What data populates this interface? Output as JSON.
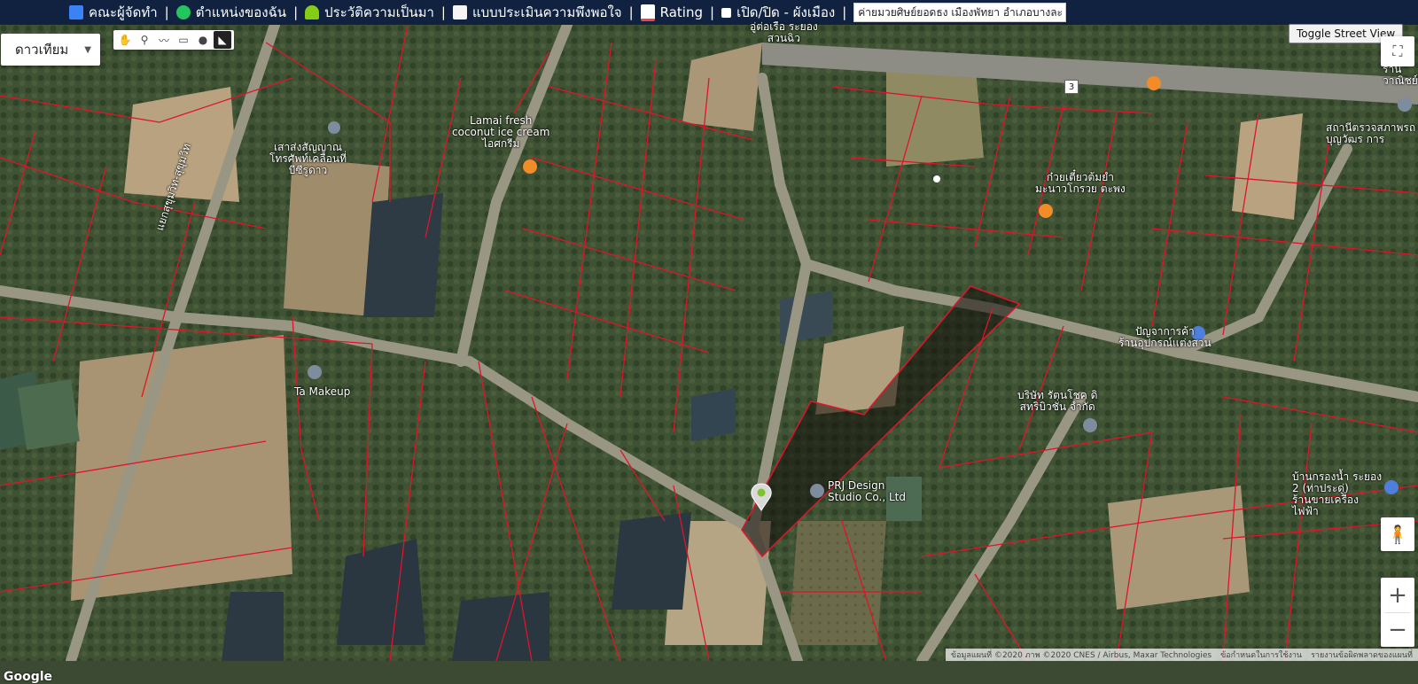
{
  "topbar": {
    "items": [
      {
        "label": "คณะผู้จัดทำ",
        "icon": "people-icon",
        "color": "#3b82f6"
      },
      {
        "label": "ตำแหน่งของฉัน",
        "icon": "globe-icon",
        "color": "#22c55e"
      },
      {
        "label": "ประวัติความเป็นมา",
        "icon": "sprout-icon",
        "color": "#84cc16"
      },
      {
        "label": "แบบประเมินความพึงพอใจ",
        "icon": "memo-icon",
        "color": "#f5f5f5"
      },
      {
        "label": "Rating",
        "icon": "chart-icon",
        "color": "#ef4444"
      },
      {
        "label": "เปิด/ปิด - ผังเมือง",
        "icon": "checkbox-icon",
        "color": "#ffffff"
      }
    ],
    "search_value": "ค่ายมวยศิษย์ยอดธง เมืองพัทยา อำเภอบางละ"
  },
  "map": {
    "map_type": "ดาวเทียม",
    "toggle_street_view": "Toggle Street View",
    "google": "Google",
    "route_number": "3",
    "attribution": [
      "ข้อมูลแผนที่ ©2020 ภาพ ©2020 CNES / Airbus, Maxar Technologies",
      "ข้อกำหนดในการใช้งาน",
      "รายงานข้อผิดพลาดของแผนที่"
    ],
    "labels": [
      {
        "id": "lamai",
        "text": "Lamai fresh\ncoconut ice cream\nไอศกรีม"
      },
      {
        "id": "kuaytiew",
        "text": "ก๋วยเตี๋ยวต้มยำ\nมะนาวโกรวย ตะพง"
      },
      {
        "id": "ta-makeup",
        "text": "Ta Makeup"
      },
      {
        "id": "prj",
        "text": "PRJ Design\nStudio Co., Ltd"
      },
      {
        "id": "company",
        "text": "บริษัท รัตนโชค ดิ\nสทริบิวชั่น จำกัด"
      },
      {
        "id": "panya",
        "text": "ปัญจาการค้า\nร้านอุปกรณ์แต่งสวน"
      },
      {
        "id": "baan",
        "text": "บ้านกรองน้ำ ระยอง\n2 (ท่าประดู่)\nร้านขายเครื่อง\nไฟฟ้า"
      },
      {
        "id": "station",
        "text": "สถานีตรวจสภาพรถ\nบุญวัฒร การ"
      },
      {
        "id": "laos",
        "text": "เสาส่งสัญญาณ\nโทรศัพท์เคลื่อนที่\nบีซีรูดาว"
      },
      {
        "id": "sukhumvit1",
        "text": "แยกสุขุมวิท-สุขุมวิท"
      },
      {
        "id": "top-center",
        "text": "อู่ต่อเรือ ระยอง\nสวนฉิว"
      },
      {
        "id": "shop-right",
        "text": "ร้าน\nวาณิชย์"
      }
    ]
  }
}
